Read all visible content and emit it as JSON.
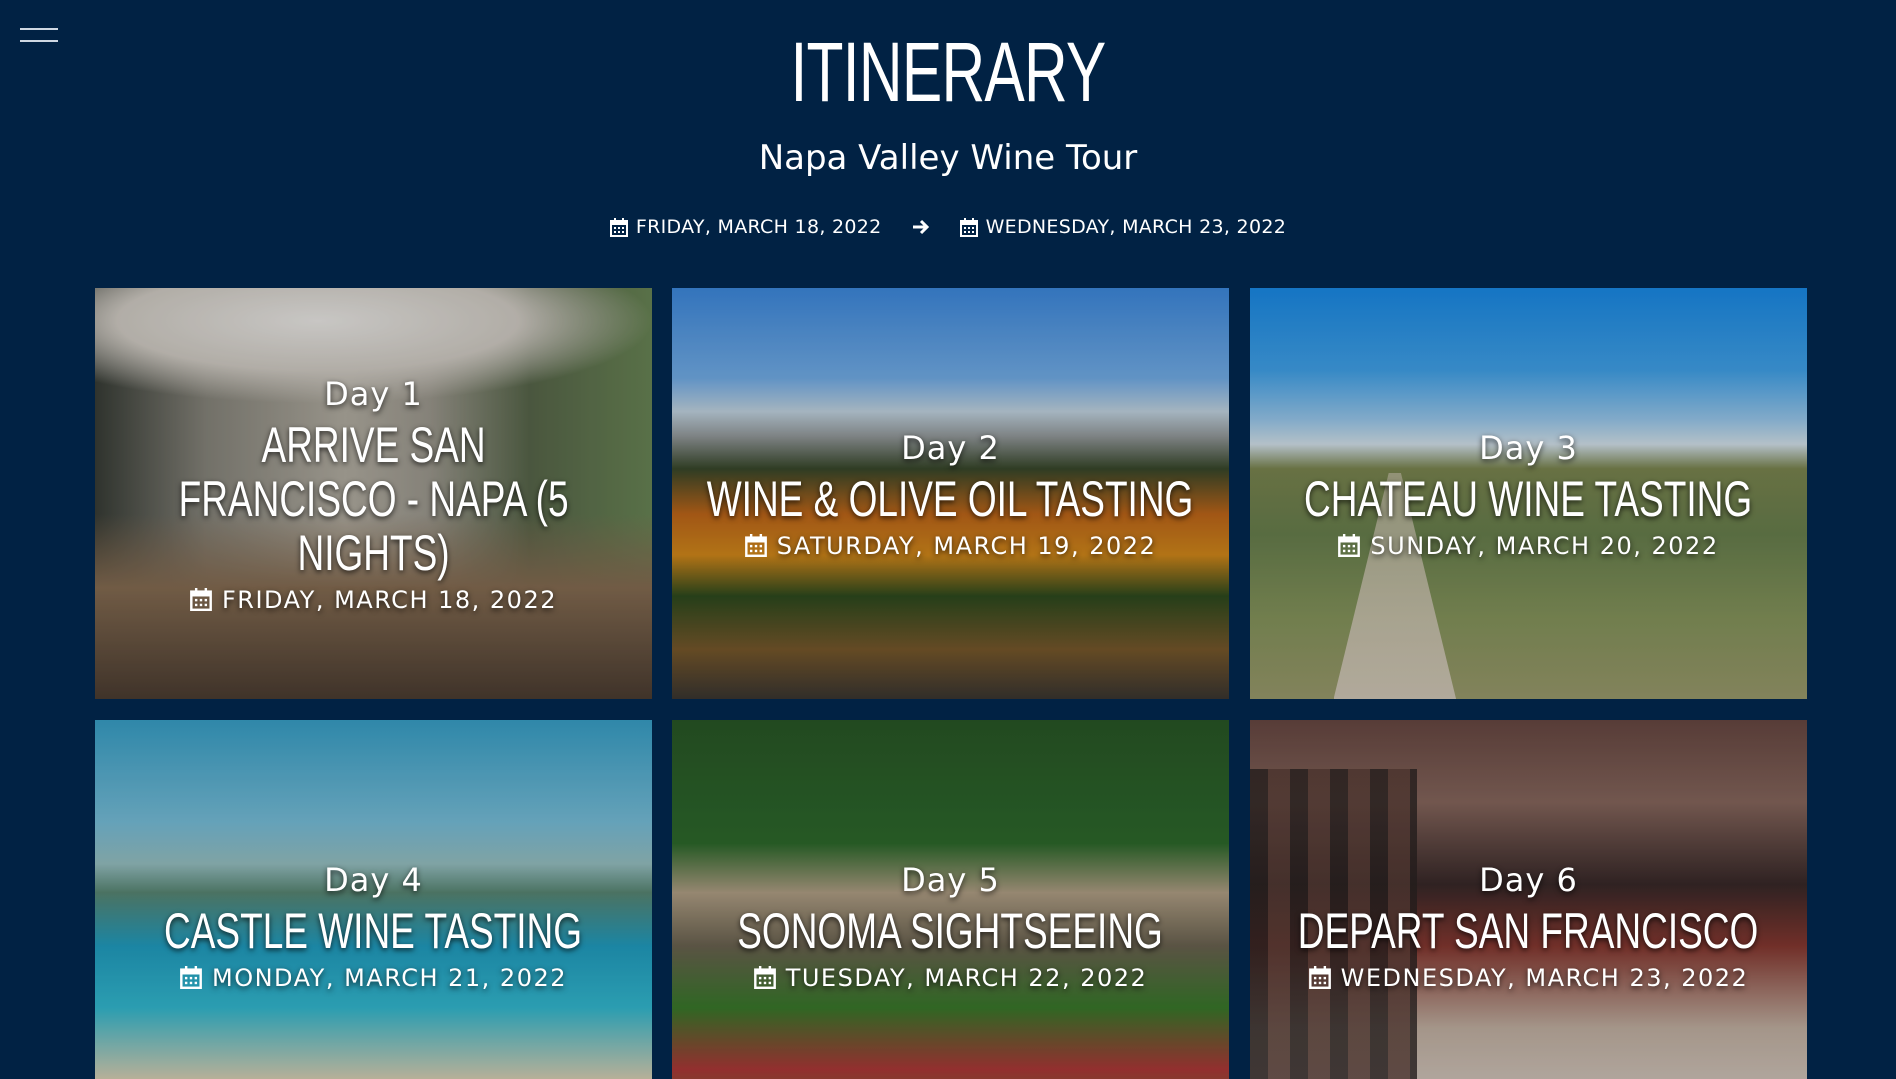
{
  "header": {
    "title": "ITINERARY",
    "subtitle": "Napa Valley Wine Tour",
    "start_date": "FRIDAY, MARCH 18, 2022",
    "end_date": "WEDNESDAY, MARCH 23, 2022"
  },
  "cards": [
    {
      "day": "Day 1",
      "title": "ARRIVE SAN FRANCISCO - NAPA (5 NIGHTS)",
      "date": "FRIDAY, MARCH 18, 2022"
    },
    {
      "day": "Day 2",
      "title": "WINE & OLIVE OIL TASTING",
      "date": "SATURDAY, MARCH 19, 2022"
    },
    {
      "day": "Day 3",
      "title": "CHATEAU WINE TASTING",
      "date": "SUNDAY, MARCH 20, 2022"
    },
    {
      "day": "Day 4",
      "title": "CASTLE WINE TASTING",
      "date": "MONDAY, MARCH 21, 2022"
    },
    {
      "day": "Day 5",
      "title": "SONOMA SIGHTSEEING",
      "date": "TUESDAY, MARCH 22, 2022"
    },
    {
      "day": "Day 6",
      "title": "DEPART SAN FRANCISCO",
      "date": "WEDNESDAY, MARCH 23, 2022"
    }
  ],
  "icons": {
    "calendar": "calendar-icon",
    "arrow": "arrow-right-icon",
    "menu": "hamburger-menu-icon"
  },
  "colors": {
    "background": "#012244",
    "text": "#ffffff"
  }
}
